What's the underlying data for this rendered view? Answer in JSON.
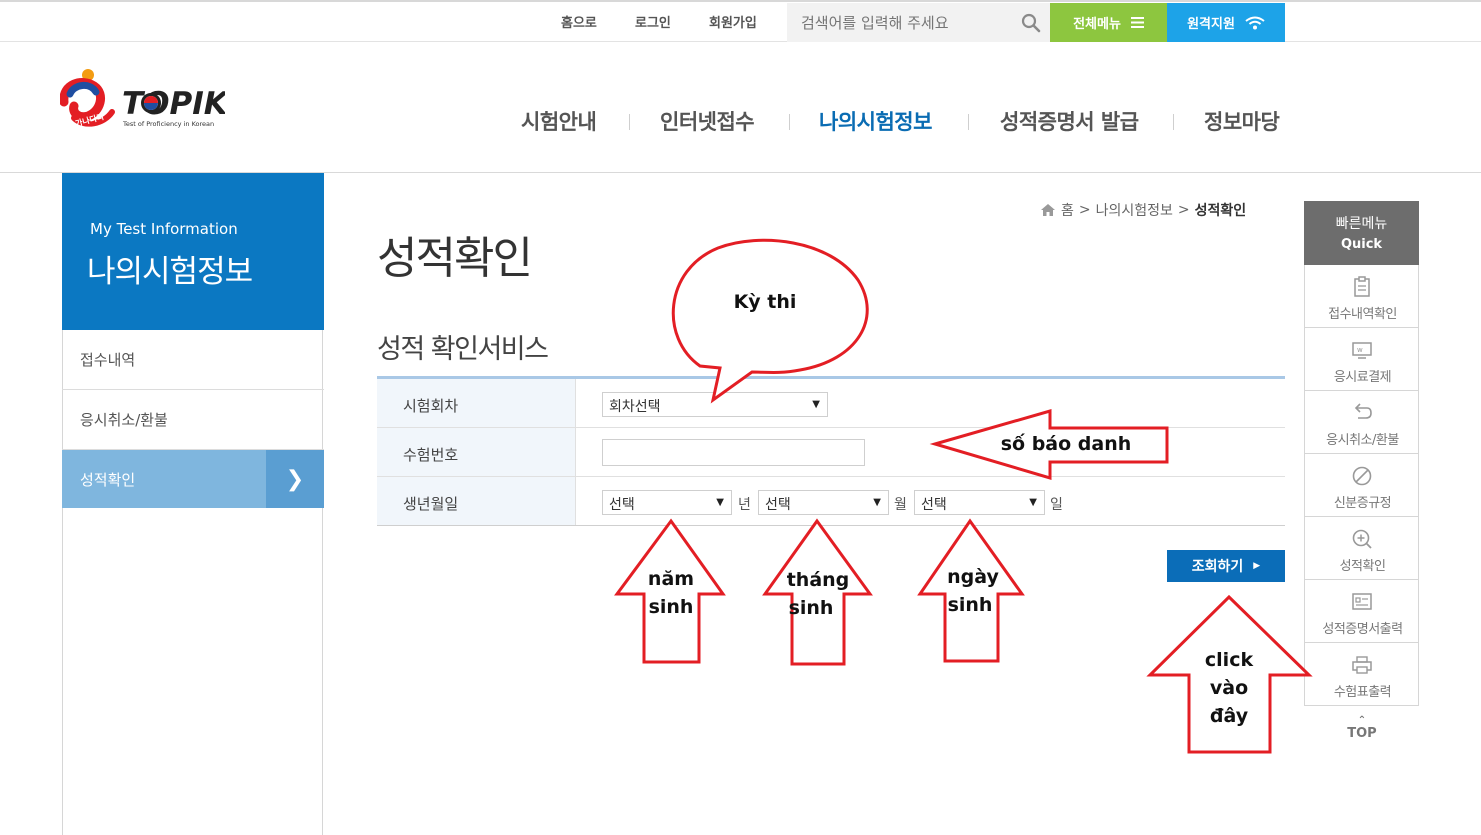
{
  "topbar": {
    "links": [
      "홈으로",
      "로그인",
      "회원가입"
    ],
    "search_placeholder": "검색어를 입력해 주세요",
    "all_menu": "전체메뉴",
    "remote_support": "원격지원"
  },
  "logo": {
    "wordmark": "TOPIK",
    "tagline": "Test of Proficiency in Korean",
    "badge": "가나다라"
  },
  "gnb": {
    "items": [
      "시험안내",
      "인터넷접수",
      "나의시험정보",
      "성적증명서 발급",
      "정보마당"
    ],
    "active_index": 2
  },
  "lnb": {
    "title_en": "My Test Information",
    "title_ko": "나의시험정보",
    "items": [
      "접수내역",
      "응시취소/환불",
      "성적확인"
    ],
    "active_index": 2
  },
  "breadcrumb": {
    "home": "홈",
    "sep": ">",
    "level1": "나의시험정보",
    "current": "성적확인"
  },
  "page": {
    "title": "성적확인",
    "subtitle": "성적 확인서비스"
  },
  "form": {
    "round_label": "시험회차",
    "round_select": "회차선택",
    "number_label": "수험번호",
    "number_value": "",
    "birth_label": "생년월일",
    "year_select": "선택",
    "year_unit": "년",
    "month_select": "선택",
    "month_unit": "월",
    "day_select": "선택",
    "day_unit": "일"
  },
  "search_button": "조회하기",
  "quick": {
    "title_ko": "빠른메뉴",
    "title_en": "Quick",
    "items": [
      "접수내역확인",
      "응시료결제",
      "응시취소/환불",
      "신분증규정",
      "성적확인",
      "성적증명서출력",
      "수험표출력"
    ],
    "top": "TOP"
  },
  "annotations": {
    "bubble": "Kỳ thi",
    "id_arrow": "số báo danh",
    "year_arrow": [
      "năm",
      "sinh"
    ],
    "month_arrow": [
      "tháng",
      "sinh"
    ],
    "day_arrow": [
      "ngày",
      "sinh"
    ],
    "click_arrow": [
      "click",
      "vào",
      "đây"
    ]
  },
  "colors": {
    "brand_blue": "#0b78c2",
    "menu_green": "#8dc63f",
    "remote_blue": "#1da3e8",
    "annotation_red": "#e31e24"
  }
}
